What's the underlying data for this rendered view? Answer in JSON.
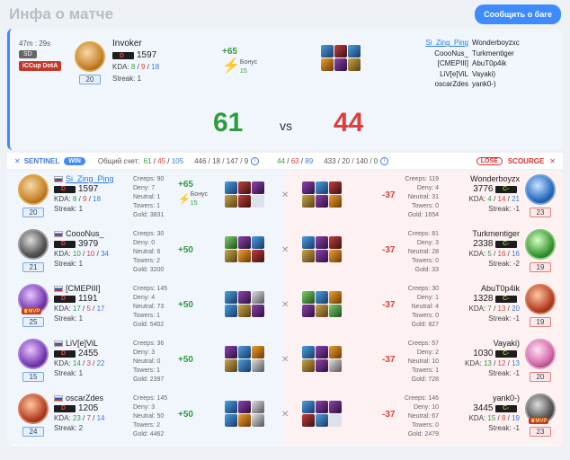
{
  "page": {
    "title": "Инфа о матче",
    "report_button": "Сообщить о баге"
  },
  "match": {
    "duration": "47m : 29s",
    "mode": "SD",
    "league": "iCCup DotA",
    "score_sentinel": "61",
    "score_scourge": "44",
    "vs": "vs",
    "player": {
      "name": "Invoker",
      "mmr": "1597",
      "kda_label": "KDA:",
      "k": "8",
      "d": "9",
      "a": "18",
      "streak": "Streak: 1",
      "level": "20",
      "gain": "+65",
      "bonus_label": "Бонус",
      "bonus_value": "15"
    },
    "roster_left": [
      "Si_Zing_Ping",
      "CoooNus_",
      "[CMEPIII]",
      "LiV[e]ViL",
      "oscarZdes"
    ],
    "roster_right": [
      "Wonderboyzxc",
      "Turkmentiger",
      "AbuT0p4ik",
      "Vayaki)",
      "yank0-)"
    ]
  },
  "team_bar": {
    "sentinel": "SENTINEL",
    "win": "WIN",
    "total_label": "Общий счет:",
    "s_k": "61",
    "s_d": "45",
    "s_a": "105",
    "s_extra": "446 / 18 / 147 / 9",
    "c_k": "44",
    "c_d": "63",
    "c_a": "89",
    "c_extra": "433 / 20 / 140 / 0",
    "lose": "LOSE",
    "scourge": "SCOURGE"
  },
  "stat_labels": {
    "creeps": "Creeps",
    "deny": "Deny",
    "neutral": "Neutral",
    "towers": "Towers",
    "gold": "Gold",
    "kda": "KDA:",
    "streak": "Streak:",
    "bonus": "Бонус",
    "mvp": "MVP"
  },
  "rows": [
    {
      "left": {
        "name": "Si_Zing_Ping",
        "link": true,
        "mmr": "1597",
        "k": "8",
        "d": "9",
        "a": "18",
        "streak": "1",
        "level": "20",
        "creeps": "90",
        "deny": "7",
        "neutral": "1",
        "towers": "1",
        "gold": "3831",
        "gain": "+65",
        "bonus": "15",
        "mvp": false
      },
      "right": {
        "name": "Wonderboyzx",
        "mmr": "3776",
        "k": "4",
        "d": "14",
        "a": "21",
        "streak": "-1",
        "level": "23",
        "creeps": "119",
        "deny": "4",
        "neutral": "31",
        "towers": "0",
        "gold": "1654",
        "gain": "-37",
        "mvp": false
      }
    },
    {
      "left": {
        "name": "CoooNus_",
        "link": false,
        "mmr": "3979",
        "k": "10",
        "d": "10",
        "a": "34",
        "streak": "1",
        "level": "21",
        "creeps": "30",
        "deny": "0",
        "neutral": "6",
        "towers": "2",
        "gold": "3200",
        "gain": "+50",
        "mvp": false
      },
      "right": {
        "name": "Turkmentiger",
        "mmr": "2338",
        "k": "5",
        "d": "16",
        "a": "16",
        "streak": "-2",
        "level": "19",
        "creeps": "81",
        "deny": "3",
        "neutral": "28",
        "towers": "0",
        "gold": "33",
        "gain": "-37",
        "mvp": false
      }
    },
    {
      "left": {
        "name": "[CMEPIII]",
        "link": false,
        "mmr": "1191",
        "k": "17",
        "d": "5",
        "a": "17",
        "streak": "1",
        "level": "25",
        "creeps": "145",
        "deny": "4",
        "neutral": "73",
        "towers": "1",
        "gold": "5402",
        "gain": "+50",
        "mvp": true
      },
      "right": {
        "name": "AbuT0p4ik",
        "mmr": "1328",
        "k": "7",
        "d": "13",
        "a": "20",
        "streak": "-1",
        "level": "19",
        "creeps": "30",
        "deny": "1",
        "neutral": "4",
        "towers": "0",
        "gold": "827",
        "gain": "-37",
        "mvp": false
      }
    },
    {
      "left": {
        "name": "LiV[e]ViL",
        "link": false,
        "mmr": "2455",
        "k": "14",
        "d": "3",
        "a": "22",
        "streak": "1",
        "level": "15",
        "creeps": "36",
        "deny": "3",
        "neutral": "0",
        "towers": "1",
        "gold": "2397",
        "gain": "+50",
        "mvp": false
      },
      "right": {
        "name": "Vayaki)",
        "mmr": "1030",
        "k": "13",
        "d": "12",
        "a": "13",
        "streak": "-1",
        "level": "20",
        "creeps": "57",
        "deny": "2",
        "neutral": "10",
        "towers": "1",
        "gold": "728",
        "gain": "-37",
        "mvp": false
      }
    },
    {
      "left": {
        "name": "oscarZdes",
        "link": false,
        "mmr": "1205",
        "k": "23",
        "d": "7",
        "a": "14",
        "streak": "2",
        "level": "24",
        "creeps": "145",
        "deny": "3",
        "neutral": "50",
        "towers": "2",
        "gold": "4462",
        "gain": "+50",
        "mvp": false
      },
      "right": {
        "name": "yank0-)",
        "mmr": "3445",
        "k": "15",
        "d": "8",
        "a": "19",
        "streak": "-1",
        "level": "23",
        "creeps": "146",
        "deny": "10",
        "neutral": "67",
        "towers": "0",
        "gold": "2479",
        "gain": "-37",
        "mvp": true
      }
    }
  ]
}
